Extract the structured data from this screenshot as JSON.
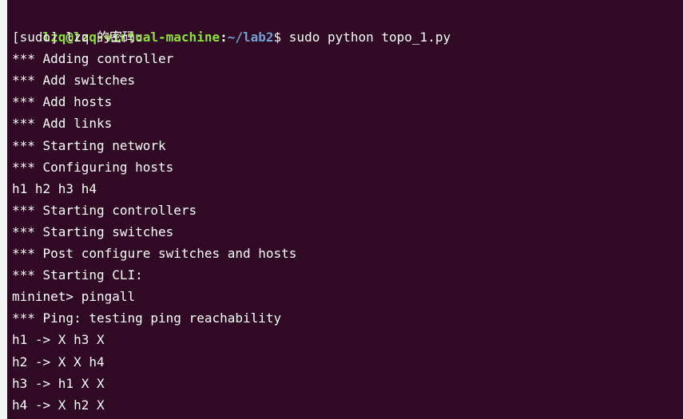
{
  "terminal": {
    "prompt": {
      "user_host": "lzq@lzq-virtual-machine",
      "colon": ":",
      "cwd": "~/lab2",
      "symbol": "$ ",
      "command": "sudo python topo_1.py"
    },
    "lines": [
      "[sudo] lzq 的密码:",
      "*** Adding controller",
      "*** Add switches",
      "*** Add hosts",
      "*** Add links",
      "*** Starting network",
      "*** Configuring hosts",
      "h1 h2 h3 h4",
      "*** Starting controllers",
      "*** Starting switches",
      "*** Post configure switches and hosts",
      "*** Starting CLI:",
      "mininet> pingall",
      "*** Ping: testing ping reachability",
      "h1 -> X h3 X",
      "h2 -> X X h4",
      "h3 -> h1 X X",
      "h4 -> X h2 X"
    ],
    "colors": {
      "background": "#300a24",
      "user_host": "#8ae234",
      "path": "#729fcf",
      "text": "#ffffff"
    }
  }
}
